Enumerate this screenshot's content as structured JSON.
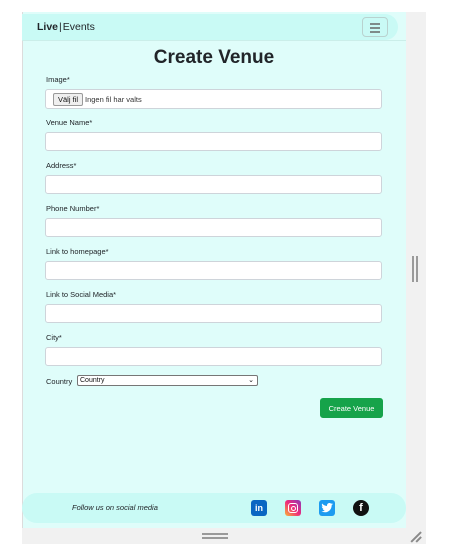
{
  "navbar": {
    "brand_bold": "Live",
    "brand_separator": "|",
    "brand_rest": "Events",
    "menu_icon": "hamburger-icon"
  },
  "page": {
    "title": "Create Venue"
  },
  "form": {
    "image": {
      "label": "Image*",
      "button_label": "Välj fil",
      "status_text": "Ingen fil har valts"
    },
    "venue_name": {
      "label": "Venue Name*",
      "value": ""
    },
    "address": {
      "label": "Address*",
      "value": ""
    },
    "phone_number": {
      "label": "Phone Number*",
      "value": ""
    },
    "homepage_link": {
      "label": "Link to homepage*",
      "value": ""
    },
    "social_media_link": {
      "label": "Link to Social Media*",
      "value": ""
    },
    "city": {
      "label": "City*",
      "value": ""
    },
    "country": {
      "label": "Country",
      "selected": "Country"
    },
    "submit_label": "Create Venue"
  },
  "footer": {
    "text": "Follow us on social media",
    "social": [
      {
        "name": "linkedin-icon",
        "glyph": "in",
        "color": "#0a66c2"
      },
      {
        "name": "instagram-icon",
        "color": "#ee2a7b"
      },
      {
        "name": "twitter-icon",
        "color": "#1d9bf0"
      },
      {
        "name": "facebook-icon",
        "glyph": "f",
        "color": "#111111"
      }
    ]
  },
  "colors": {
    "page_background": "#dffdfa",
    "bar_background": "#c9faf5",
    "submit_button": "#16a34a"
  }
}
